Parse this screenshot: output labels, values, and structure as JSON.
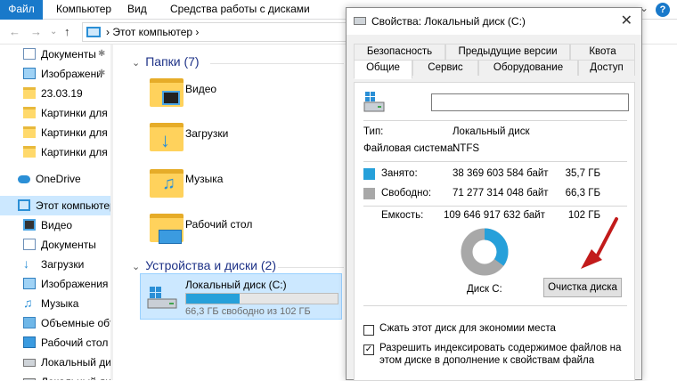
{
  "ribbon": {
    "tabs": [
      "Файл",
      "Компьютер",
      "Вид",
      "Средства работы с дисками"
    ],
    "help": "?"
  },
  "address": {
    "path": "Этот компьютер"
  },
  "sidebar": {
    "items": [
      {
        "label": "Документы",
        "icon": "document-icon",
        "pinned": true
      },
      {
        "label": "Изображени",
        "icon": "images-icon",
        "pinned": true
      },
      {
        "label": "23.03.19",
        "icon": "folder-icon"
      },
      {
        "label": "Картинки для те",
        "icon": "folder-icon"
      },
      {
        "label": "Картинки для те",
        "icon": "folder-icon"
      },
      {
        "label": "Картинки для те",
        "icon": "folder-icon"
      },
      {
        "label": "OneDrive",
        "icon": "onedrive-icon"
      },
      {
        "label": "Этот компьютер",
        "icon": "computer-icon",
        "selected": true
      },
      {
        "label": "Видео",
        "icon": "video-icon"
      },
      {
        "label": "Документы",
        "icon": "document-icon"
      },
      {
        "label": "Загрузки",
        "icon": "download-icon"
      },
      {
        "label": "Изображения",
        "icon": "images-icon"
      },
      {
        "label": "Музыка",
        "icon": "music-icon"
      },
      {
        "label": "Объемные объ",
        "icon": "3d-objects-icon"
      },
      {
        "label": "Рабочий стол",
        "icon": "desktop-icon"
      },
      {
        "label": "Локальный дис",
        "icon": "drive-icon"
      },
      {
        "label": "Локальный дис",
        "icon": "drive-icon"
      }
    ]
  },
  "main": {
    "folders_header": "Папки (7)",
    "folders": [
      "Видео",
      "Загрузки",
      "Музыка",
      "Рабочий стол"
    ],
    "devices_header": "Устройства и диски (2)",
    "drive": {
      "name": "Локальный диск (C:)",
      "free_text": "66,3 ГБ свободно из 102 ГБ",
      "used_fraction": 0.35
    }
  },
  "dialog": {
    "title": "Свойства: Локальный диск (C:)",
    "tabs_back": [
      "Безопасность",
      "Предыдущие версии",
      "Квота"
    ],
    "tabs_front": [
      "Общие",
      "Сервис",
      "Оборудование",
      "Доступ"
    ],
    "name_value": "",
    "type_label": "Тип:",
    "type_value": "Локальный диск",
    "fs_label": "Файловая система:",
    "fs_value": "NTFS",
    "used_label": "Занято:",
    "used_bytes": "38 369 603 584 байт",
    "used_gb": "35,7 ГБ",
    "free_label": "Свободно:",
    "free_bytes": "71 277 314 048 байт",
    "free_gb": "66,3 ГБ",
    "cap_label": "Емкость:",
    "cap_bytes": "109 646 917 632 байт",
    "cap_gb": "102 ГБ",
    "disk_label": "Диск C:",
    "cleanup_button": "Очистка диска",
    "compress_label": "Сжать этот диск для экономии места",
    "compress_checked": false,
    "index_label": "Разрешить индексировать содержимое файлов на этом диске в дополнение к свойствам файла",
    "index_checked": true,
    "used_fraction": 0.35,
    "colors": {
      "used": "#26a0da",
      "free": "#a8a8a8"
    }
  }
}
